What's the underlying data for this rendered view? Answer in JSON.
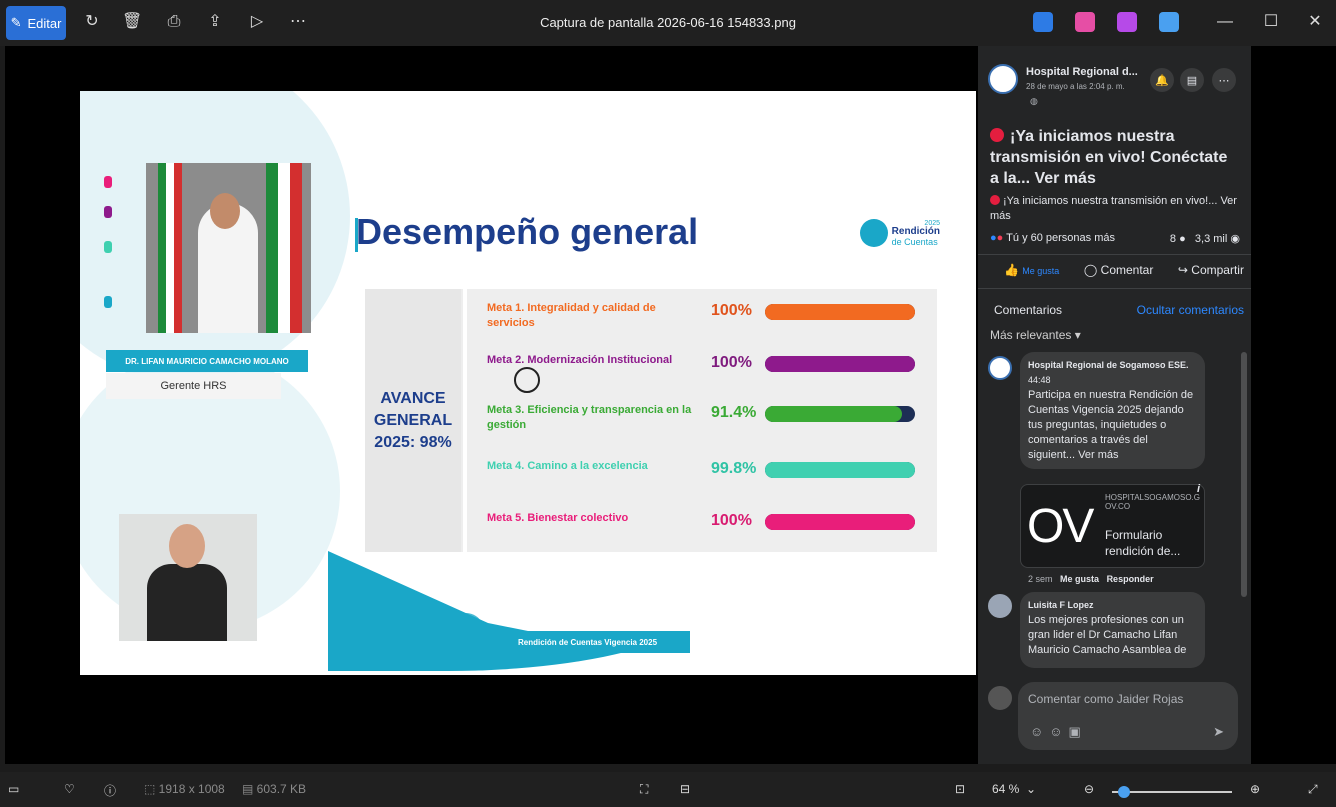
{
  "window": {
    "title": "Captura de pantalla 2026-06-16 154833.png",
    "edit_label": "Editar"
  },
  "toolbar": {
    "icons": [
      "rotate-icon",
      "delete-icon",
      "print-icon",
      "share-icon",
      "slideshow-icon",
      "more-icon"
    ]
  },
  "slide": {
    "title": "Desempeño general",
    "logo_line1": "Rendición",
    "logo_line2": "de Cuentas",
    "logo_year": "2025",
    "speaker_name": "DR. LIFAN MAURICIO CAMACHO MOLANO",
    "speaker_role": "Gerente HRS",
    "avance_text": "AVANCE GENERAL 2025: 98%",
    "footer_text": "Rendición de Cuentas Vigencia 2025",
    "metas": [
      {
        "label": "Meta 1. Integralidad y calidad de servicios",
        "pct": "100%",
        "value": 100,
        "color": "#f26a21",
        "pct_color": "#e0531c"
      },
      {
        "label": "Meta 2. Modernización Institucional",
        "pct": "100%",
        "value": 100,
        "color": "#8e1a8c",
        "pct_color": "#7f1b7e"
      },
      {
        "label": "Meta 3. Eficiencia y transparencia en la gestión",
        "pct": "91.4%",
        "value": 91.4,
        "color": "#3aaa35",
        "pct_color": "#3aaa35"
      },
      {
        "label": "Meta 4. Camino a la excelencia",
        "pct": "99.8%",
        "value": 99.8,
        "color": "#3fd0b0",
        "pct_color": "#2fc3a5"
      },
      {
        "label": "Meta 5. Bienestar colectivo",
        "pct": "100%",
        "value": 100,
        "color": "#e91e7a",
        "pct_color": "#d81b70"
      }
    ]
  },
  "fb": {
    "page_name": "Hospital Regional d...",
    "post_time": "28 de mayo a las 2:04 p. m.",
    "post_title": "¡Ya iniciamos nuestra transmisión en vivo! Conéctate a la... Ver más",
    "post_sub": "¡Ya iniciamos nuestra transmisión en vivo!... Ver más",
    "reactions": "Tú y 60 personas más",
    "comments_count": "8",
    "views": "3,3 mil",
    "like": "Me gusta",
    "comment": "Comentar",
    "share": "Compartir",
    "comments_label": "Comentarios",
    "hide_comments": "Ocultar comentarios",
    "sort": "Más relevantes",
    "c1_author": "Hospital Regional de Sogamoso ESE.",
    "c1_time": "44:48",
    "c1_text": "Participa en nuestra Rendición de Cuentas Vigencia 2025 dejando tus preguntas, inquietudes o comentarios a través del siguient... Ver más",
    "link_domain": "HOSPITALSOGAMOSO.GOV.CO",
    "link_title": "Formulario rendición de...",
    "link_ov": "OV",
    "c1_meta_time": "2 sem",
    "c1_meta_like": "Me gusta",
    "c1_meta_reply": "Responder",
    "c2_author": "Luisita F Lopez",
    "c2_text": "Los mejores profesiones con un gran lider el Dr Camacho Lifan Mauricio Camacho Asamblea de",
    "input_placeholder": "Comentar como Jaider Rojas"
  },
  "statusbar": {
    "dimensions": "1918 x 1008",
    "size": "603.7 KB",
    "zoom": "64 %",
    "zoom_fraction": 0.05
  }
}
